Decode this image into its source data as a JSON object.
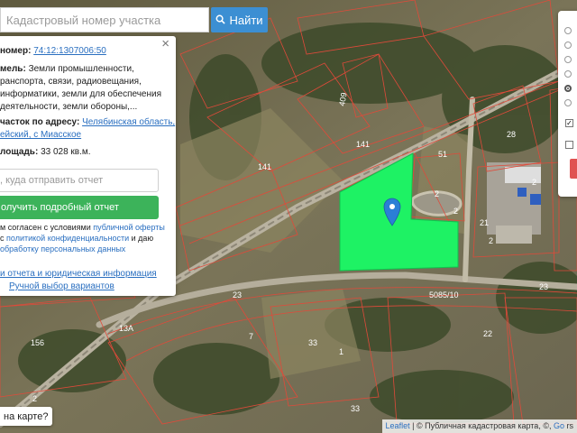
{
  "search": {
    "placeholder": "Кадастровый номер участка",
    "button_label": "Найти"
  },
  "info_panel": {
    "number_label": "номер:",
    "number_value": "74:12:1307006:50",
    "category_label": "мель:",
    "category_lines": [
      "Земли промышленности,",
      "ранспорта, связи, радиовещания,",
      "информатики, земли для обеспечения",
      "деятельности, земли обороны,..."
    ],
    "address_label": "часток по адресу:",
    "address_lines": [
      "Челябинская область,",
      "ейский, с Миасское"
    ],
    "area_label": "лощадь:",
    "area_value": "33 028 кв.м.",
    "email_placeholder": ", куда отправить отчет",
    "report_button": "олучить подробный отчет",
    "consent_lines": [
      "м согласен с условиями",
      "публичной оферты",
      "с",
      "политикой конфиденциальности",
      "и даю",
      "обработку персональных данных"
    ],
    "links": [
      "и отчета и юридическая информация",
      "Ручной выбор вариантов"
    ]
  },
  "map_labels": [
    "141",
    "141",
    "51",
    "2",
    "2",
    "21",
    "2",
    "23",
    "23",
    "5085/10",
    "13А",
    "156",
    "33",
    "22",
    "33",
    "1",
    "7",
    "2",
    "409",
    "28",
    "2"
  ],
  "onmap_button": "на карте?",
  "attribution": {
    "leaflet": "Leaflet",
    "separator": "|",
    "provider": "Публичная кадастровая карта",
    "tail": ", ©,",
    "google": "Go",
    "tail2": "rs"
  },
  "colors": {
    "parcel_highlight": "#1ef264",
    "parcel_border": "#e04a3a",
    "search_button": "#3c8fd3",
    "report_button": "#3cb35a",
    "marker": "#2b7fd6"
  }
}
